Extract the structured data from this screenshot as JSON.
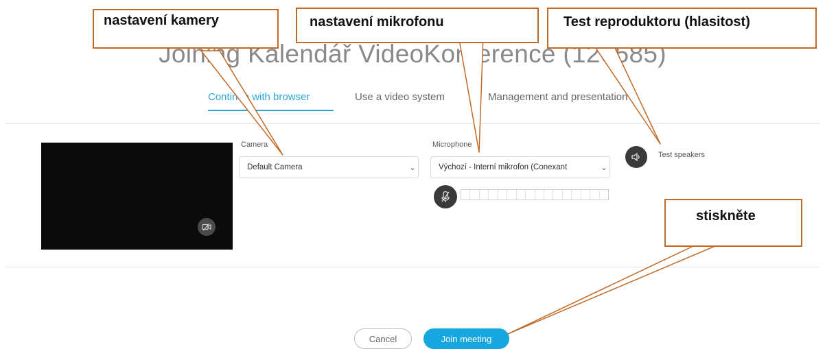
{
  "title": "Joining Kalendář VideoKonference (120585)",
  "tabs": [
    {
      "label": "Continue with browser",
      "active": true
    },
    {
      "label": "Use a video system",
      "active": false
    },
    {
      "label": "Management and presentation",
      "active": false
    }
  ],
  "camera": {
    "label": "Camera",
    "selected": "Default Camera",
    "toggle_icon": "camera-off-icon"
  },
  "microphone": {
    "label": "Microphone",
    "selected": "Výchozí - Interní mikrofon (Conexant",
    "mute_icon": "mic-muted-icon",
    "level": 0
  },
  "speakers": {
    "label": "Test speakers",
    "icon": "speaker-icon"
  },
  "buttons": {
    "cancel": "Cancel",
    "join": "Join meeting"
  },
  "annotations": {
    "camera": "nastavení kamery",
    "microphone": "nastavení mikrofonu",
    "speakers": "Test reproduktoru (hlasitost)",
    "join": "stiskněte"
  },
  "colors": {
    "accent": "#2aa6d6",
    "join_button": "#16a6e0",
    "callout_border": "#c06a26"
  }
}
